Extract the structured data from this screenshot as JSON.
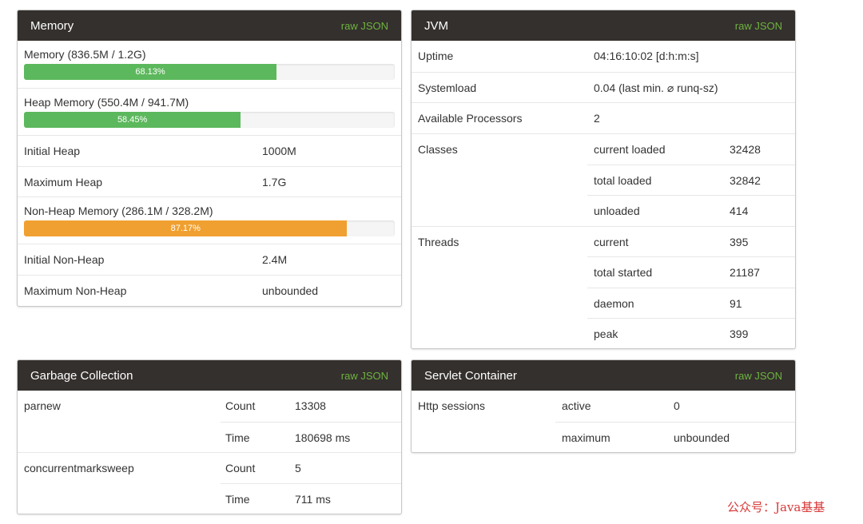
{
  "memory": {
    "title": "Memory",
    "raw_json": "raw JSON",
    "memory_label": "Memory (836.5M / 1.2G)",
    "memory_percent_text": "68.13%",
    "memory_percent": 68.13,
    "heap_label": "Heap Memory (550.4M / 941.7M)",
    "heap_percent_text": "58.45%",
    "heap_percent": 58.45,
    "initial_heap_label": "Initial Heap",
    "initial_heap_value": "1000M",
    "max_heap_label": "Maximum Heap",
    "max_heap_value": "1.7G",
    "nonheap_label": "Non-Heap Memory (286.1M / 328.2M)",
    "nonheap_percent_text": "87.17%",
    "nonheap_percent": 87.17,
    "initial_nonheap_label": "Initial Non-Heap",
    "initial_nonheap_value": "2.4M",
    "max_nonheap_label": "Maximum Non-Heap",
    "max_nonheap_value": "unbounded",
    "colors": {
      "green": "#5cb85c",
      "orange": "#f0a030"
    }
  },
  "jvm": {
    "title": "JVM",
    "raw_json": "raw JSON",
    "uptime_label": "Uptime",
    "uptime_value": "04:16:10:02 [d:h:m:s]",
    "systemload_label": "Systemload",
    "systemload_value": "0.04 (last min. ⌀ runq-sz)",
    "processors_label": "Available Processors",
    "processors_value": "2",
    "classes_label": "Classes",
    "classes": [
      {
        "label": "current loaded",
        "value": "32428"
      },
      {
        "label": "total loaded",
        "value": "32842"
      },
      {
        "label": "unloaded",
        "value": "414"
      }
    ],
    "threads_label": "Threads",
    "threads": [
      {
        "label": "current",
        "value": "395"
      },
      {
        "label": "total started",
        "value": "21187"
      },
      {
        "label": "daemon",
        "value": "91"
      },
      {
        "label": "peak",
        "value": "399"
      }
    ]
  },
  "gc": {
    "title": "Garbage Collection",
    "raw_json": "raw JSON",
    "collectors": [
      {
        "name": "parnew",
        "count_label": "Count",
        "count": "13308",
        "time_label": "Time",
        "time": "180698 ms"
      },
      {
        "name": "concurrentmarksweep",
        "count_label": "Count",
        "count": "5",
        "time_label": "Time",
        "time": "711 ms"
      }
    ]
  },
  "servlet": {
    "title": "Servlet Container",
    "raw_json": "raw JSON",
    "sessions_label": "Http sessions",
    "active_label": "active",
    "active_value": "0",
    "maximum_label": "maximum",
    "maximum_value": "unbounded"
  },
  "header_color": "#34302d",
  "accent_color": "#6db33f",
  "watermark": "公众号：Java基基"
}
